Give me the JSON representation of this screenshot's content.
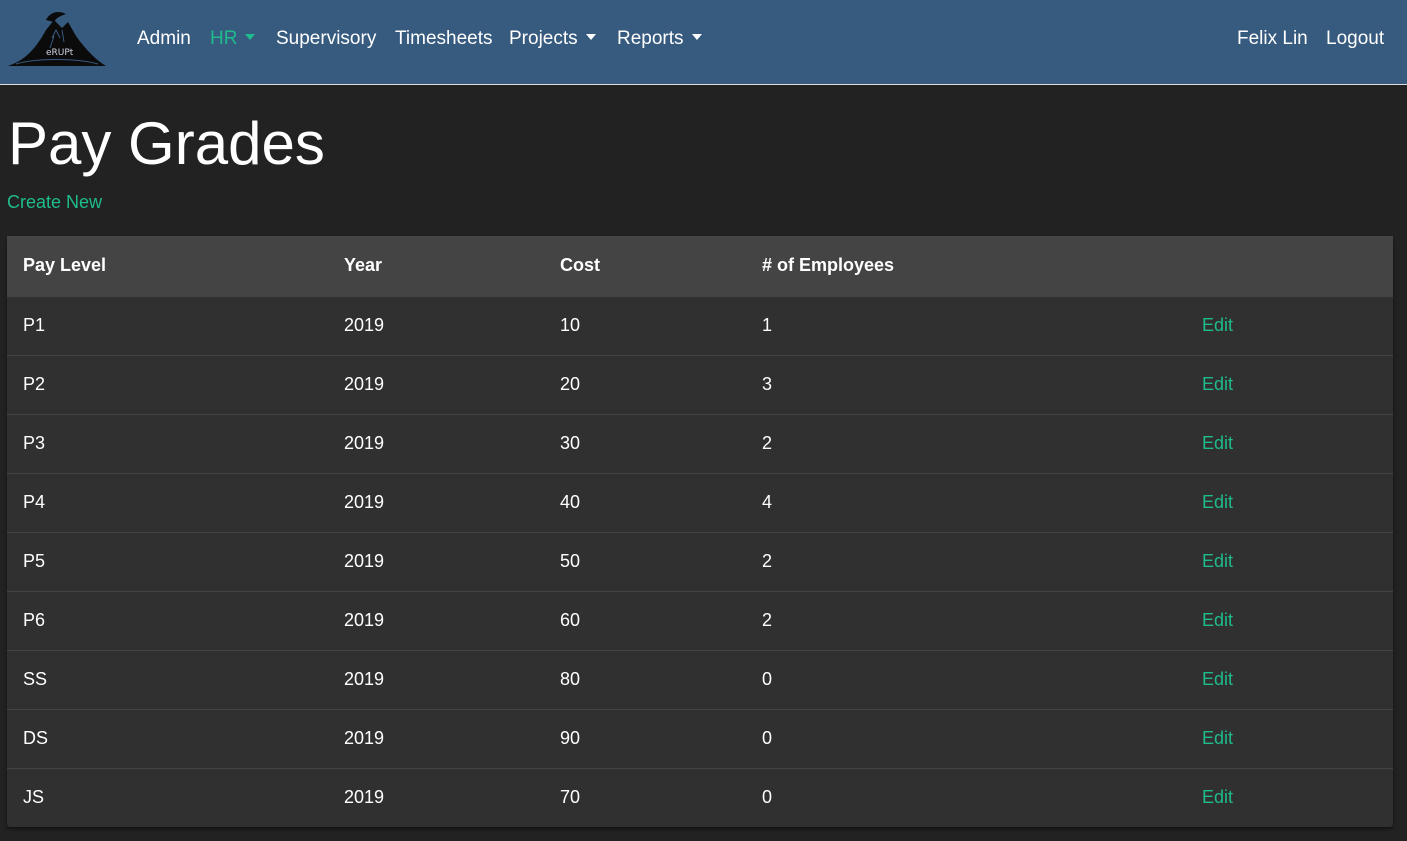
{
  "brand": {
    "logo_text": "eRUPt"
  },
  "nav": {
    "admin": "Admin",
    "hr": "HR",
    "supervisory": "Supervisory",
    "timesheets": "Timesheets",
    "projects": "Projects",
    "reports": "Reports",
    "user": "Felix Lin",
    "logout": "Logout"
  },
  "page": {
    "title": "Pay Grades",
    "create_new": "Create New"
  },
  "table": {
    "headers": [
      "Pay Level",
      "Year",
      "Cost",
      "# of Employees",
      ""
    ],
    "rows": [
      [
        "P1",
        "2019",
        "10",
        "1",
        "Edit"
      ],
      [
        "P2",
        "2019",
        "20",
        "3",
        "Edit"
      ],
      [
        "P3",
        "2019",
        "30",
        "2",
        "Edit"
      ],
      [
        "P4",
        "2019",
        "40",
        "4",
        "Edit"
      ],
      [
        "P5",
        "2019",
        "50",
        "2",
        "Edit"
      ],
      [
        "P6",
        "2019",
        "60",
        "2",
        "Edit"
      ],
      [
        "SS",
        "2019",
        "80",
        "0",
        "Edit"
      ],
      [
        "DS",
        "2019",
        "90",
        "0",
        "Edit"
      ],
      [
        "JS",
        "2019",
        "70",
        "0",
        "Edit"
      ]
    ]
  },
  "colors": {
    "navbar": "#375a7f",
    "background": "#222222",
    "accent": "#1ebc8c",
    "table_header": "#444444",
    "table_body": "#303030"
  }
}
